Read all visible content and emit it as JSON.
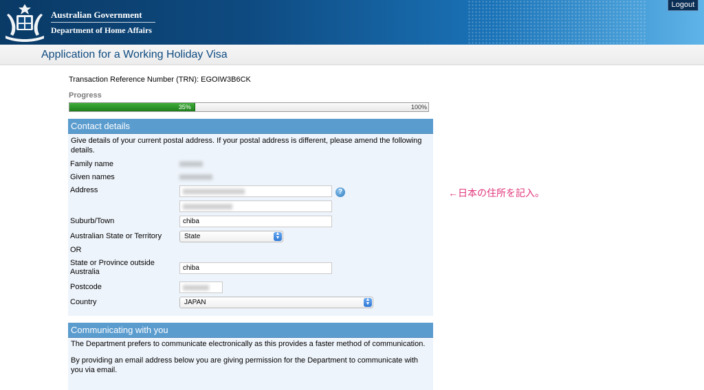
{
  "header": {
    "gov_line1": "Australian Government",
    "gov_line2": "Department of Home Affairs",
    "logout_label": "Logout"
  },
  "title": "Application for a Working Holiday Visa",
  "trn": "Transaction Reference Number (TRN): EGOIW3B6CK",
  "progress": {
    "label": "Progress",
    "percent": 35,
    "current_text": "35%",
    "end_text": "100%"
  },
  "contact": {
    "heading": "Contact details",
    "intro": "Give details of your current postal address. If your postal address is different, please amend the following details.",
    "family_name_label": "Family name",
    "given_names_label": "Given names",
    "address_label": "Address",
    "suburb_label": "Suburb/Town",
    "suburb_value": "chiba",
    "state_label": "Australian State or Territory",
    "state_value": "State",
    "or_label": "OR",
    "province_label_1": "State or Province outside",
    "province_label_2": "Australia",
    "province_value": "chiba",
    "postcode_label": "Postcode",
    "country_label": "Country",
    "country_value": "JAPAN"
  },
  "communication": {
    "heading": "Communicating with you",
    "para1": "The Department prefers to communicate electronically as this provides a faster method of communication.",
    "para2": "By providing an email address below you are giving permission for the Department to communicate with you via email."
  },
  "annotation": "←日本の住所を記入。",
  "colors": {
    "header_dark": "#0a3a66",
    "panel_head": "#5b9ccf",
    "progress_green": "#2a9426",
    "annotation_pink": "#e0357a"
  }
}
